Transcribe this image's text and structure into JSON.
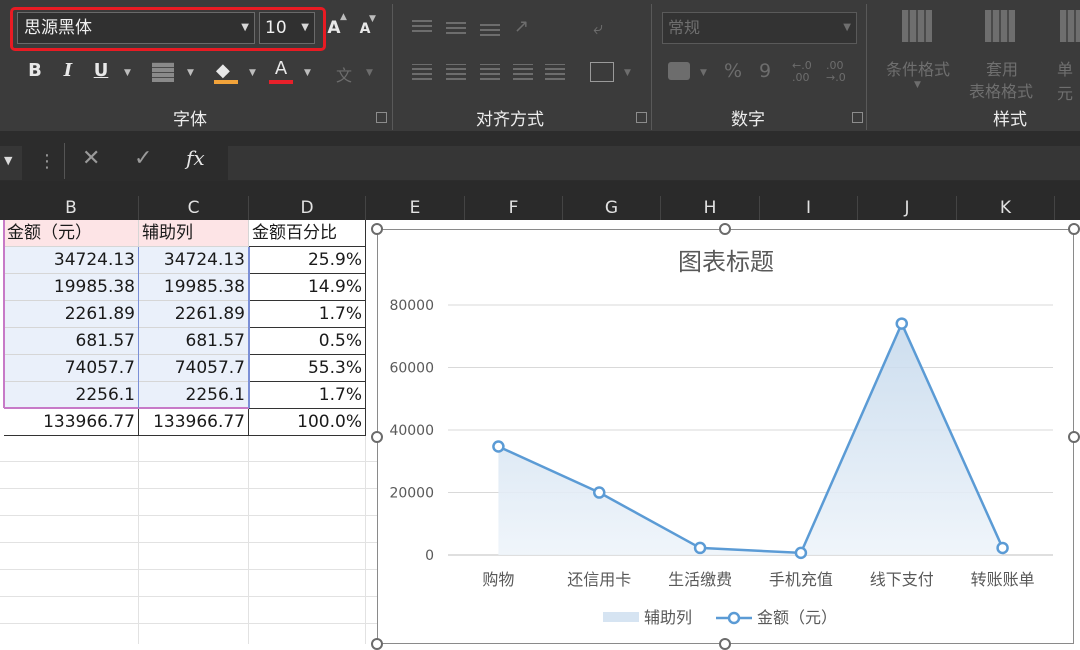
{
  "ribbon": {
    "font_name": "思源黑体",
    "font_size": "10",
    "grow_font_label": "A",
    "shrink_font_label": "A",
    "bold_label": "B",
    "italic_label": "I",
    "underline_label": "U",
    "font_color_label": "A",
    "phonetic_label": "文",
    "groups": {
      "font": "字体",
      "alignment": "对齐方式",
      "number": "数字",
      "styles": "样式"
    },
    "number_format": "常规",
    "percent_label": "%",
    "comma_label": "9",
    "conditional_format_label": "条件格式",
    "apply_label": "套用",
    "table_format_label": "表格格式",
    "cell_styles_label": "单元",
    "accent_colors": {
      "fill": "#f2a33a",
      "font": "#e8202a",
      "highlight": "#e81b23"
    }
  },
  "formula_bar": {
    "cancel_icon": "close-icon",
    "confirm_icon": "check-icon",
    "fx_label": "fx",
    "more_label": "⋮"
  },
  "columns": [
    "B",
    "C",
    "D",
    "E",
    "F",
    "G",
    "H",
    "I",
    "J",
    "K"
  ],
  "sheet": {
    "headers": [
      "金额（元）",
      "辅助列",
      "金额百分比"
    ],
    "rows": [
      [
        "34724.13",
        "34724.13",
        "25.9%"
      ],
      [
        "19985.38",
        "19985.38",
        "14.9%"
      ],
      [
        "2261.89",
        "2261.89",
        "1.7%"
      ],
      [
        "681.57",
        "681.57",
        "0.5%"
      ],
      [
        "74057.7",
        "74057.7",
        "55.3%"
      ],
      [
        "2256.1",
        "2256.1",
        "1.7%"
      ],
      [
        "133966.77",
        "133966.77",
        "100.0%"
      ]
    ]
  },
  "chart_data": {
    "type": "line",
    "title": "图表标题",
    "categories": [
      "购物",
      "还信用卡",
      "生活缴费",
      "手机充值",
      "线下支付",
      "转账账单"
    ],
    "series": [
      {
        "name": "辅助列",
        "kind": "area",
        "values": [
          34724.13,
          19985.38,
          2261.89,
          681.57,
          74057.7,
          2256.1
        ],
        "color": "#c9dcee"
      },
      {
        "name": "金额（元）",
        "kind": "line",
        "values": [
          34724.13,
          19985.38,
          2261.89,
          681.57,
          74057.7,
          2256.1
        ],
        "color": "#5b9bd5"
      }
    ],
    "y_ticks": [
      "0",
      "20000",
      "40000",
      "60000",
      "80000"
    ],
    "ylim": [
      0,
      80000
    ],
    "grid": true,
    "legend": "bottom"
  }
}
